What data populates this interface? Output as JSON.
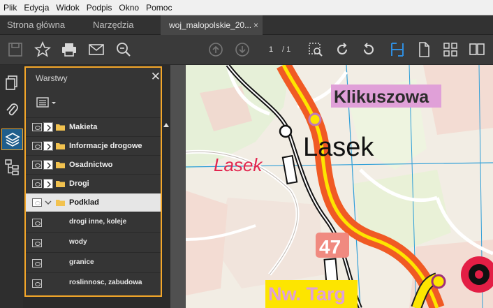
{
  "menu": [
    "Plik",
    "Edycja",
    "Widok",
    "Podpis",
    "Okno",
    "Pomoc"
  ],
  "tabs": {
    "home": "Strona główna",
    "tools": "Narzędzia",
    "document": "woj_malopolskie_20...",
    "close": "×"
  },
  "toolbar": {
    "page_current": "1",
    "page_total": "/ 1",
    "icons": [
      "save-icon",
      "bookmark-star-icon",
      "print-icon",
      "mail-icon",
      "zoom-search-icon",
      "page-up-icon",
      "page-down-icon",
      "marquee-zoom-icon",
      "rotate-cw-icon",
      "rotate-ccw-icon",
      "fit-width-icon",
      "single-page-icon",
      "fit-spread-icon",
      "two-page-icon"
    ]
  },
  "sidebar": {
    "icons": [
      "pages-icon",
      "attachments-icon",
      "layers-icon",
      "structure-icon"
    ]
  },
  "layers_panel": {
    "title": "Warstwy",
    "close": "✕",
    "layers": [
      {
        "label": "Makieta",
        "expanded": false
      },
      {
        "label": "Informacje drogowe",
        "expanded": false
      },
      {
        "label": "Osadnictwo",
        "expanded": false
      },
      {
        "label": "Drogi",
        "expanded": false
      },
      {
        "label": "Podklad",
        "expanded": true,
        "selected": true
      }
    ],
    "sublayers": [
      "drogi inne, koleje",
      "wody",
      "granice",
      "roslinnosc, zabudowa"
    ]
  },
  "map": {
    "label_town_1": "Klikuszowa",
    "label_town_2": "Lasek",
    "label_village": "Lasek",
    "road_number": "47",
    "label_town_3": "Nw. Targ",
    "colors": {
      "road_main": "#f05a24",
      "road_center": "#fde500",
      "town_label_bg": "#e0a0d8",
      "village_label": "#e2264f",
      "grid": "#2f9fd8"
    }
  }
}
